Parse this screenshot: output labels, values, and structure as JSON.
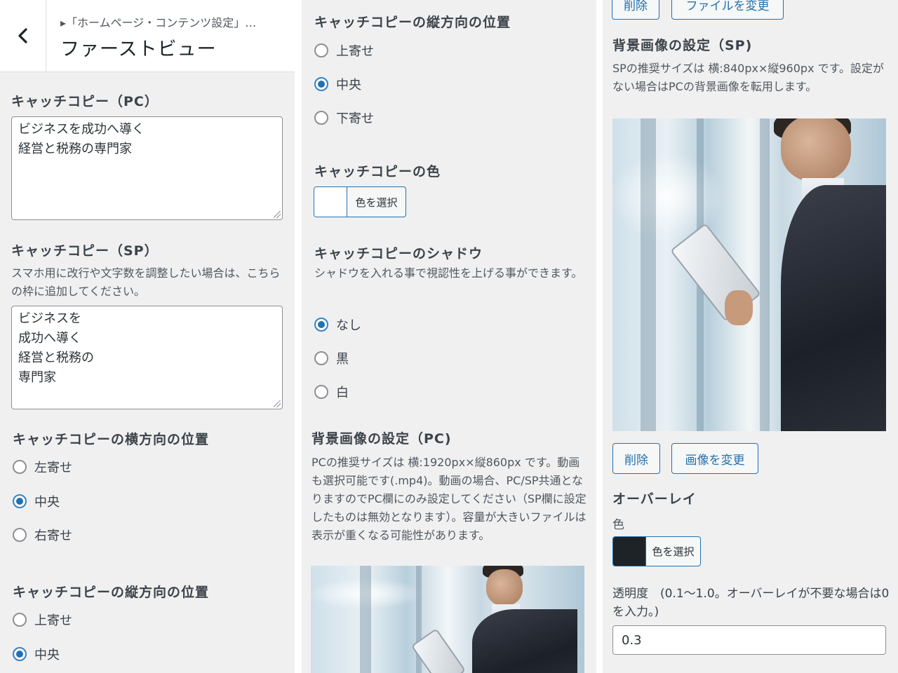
{
  "header": {
    "breadcrumb": "▸「ホームページ・コンテンツ設定」…",
    "title": "ファーストビュー",
    "back_icon": "chevron-left-icon"
  },
  "col1": {
    "catch_pc": {
      "heading": "キャッチコピー（PC）",
      "value": "ビジネスを成功へ導く\n経営と税務の専門家"
    },
    "catch_sp": {
      "heading": "キャッチコピー（SP）",
      "desc": "スマホ用に改行や文字数を調整したい場合は、こちらの枠に追加してください。",
      "value": "ビジネスを\n成功へ導く\n経営と税務の\n専門家"
    },
    "h_position": {
      "heading": "キャッチコピーの横方向の位置",
      "options": [
        "左寄せ",
        "中央",
        "右寄せ"
      ],
      "selected": "中央"
    },
    "v_position": {
      "heading": "キャッチコピーの縦方向の位置",
      "options": [
        "上寄せ",
        "中央"
      ],
      "selected": "中央"
    }
  },
  "col2": {
    "v_position": {
      "heading": "キャッチコピーの縦方向の位置",
      "options": [
        "上寄せ",
        "中央",
        "下寄せ"
      ],
      "selected": "中央"
    },
    "color": {
      "heading": "キャッチコピーの色",
      "button_label": "色を選択",
      "swatch": "#ffffff"
    },
    "shadow": {
      "heading": "キャッチコピーのシャドウ",
      "desc": "シャドウを入れる事で視認性を上げる事ができます。",
      "options": [
        "なし",
        "黒",
        "白"
      ],
      "selected": "なし"
    },
    "bg_pc": {
      "heading": "背景画像の設定（PC)",
      "desc": "PCの推奨サイズは 横:1920px×縦860px です。動画も選択可能です(.mp4)。動画の場合、PC/SP共通となりますのでPC欄にのみ設定してください（SP欄に設定したものは無効となります）。容量が大きいファイルは表示が重くなる可能性があります。"
    }
  },
  "col3": {
    "top_buttons": {
      "delete": "削除",
      "change_file": "ファイルを変更"
    },
    "bg_sp": {
      "heading": "背景画像の設定（SP)",
      "desc": "SPの推奨サイズは 横:840px×縦960px です。設定がない場合はPCの背景画像を転用します。"
    },
    "buttons": {
      "delete": "削除",
      "change_image": "画像を変更"
    },
    "overlay": {
      "heading": "オーバーレイ",
      "color_label": "色",
      "button_label": "色を選択",
      "swatch": "#1d2327",
      "opacity_label": "透明度　(0.1〜1.0。オーバーレイが不要な場合は0を入力。)",
      "opacity_value": "0.3"
    }
  },
  "colors": {
    "accent": "#2271b1",
    "background": "#f0f0f1"
  }
}
